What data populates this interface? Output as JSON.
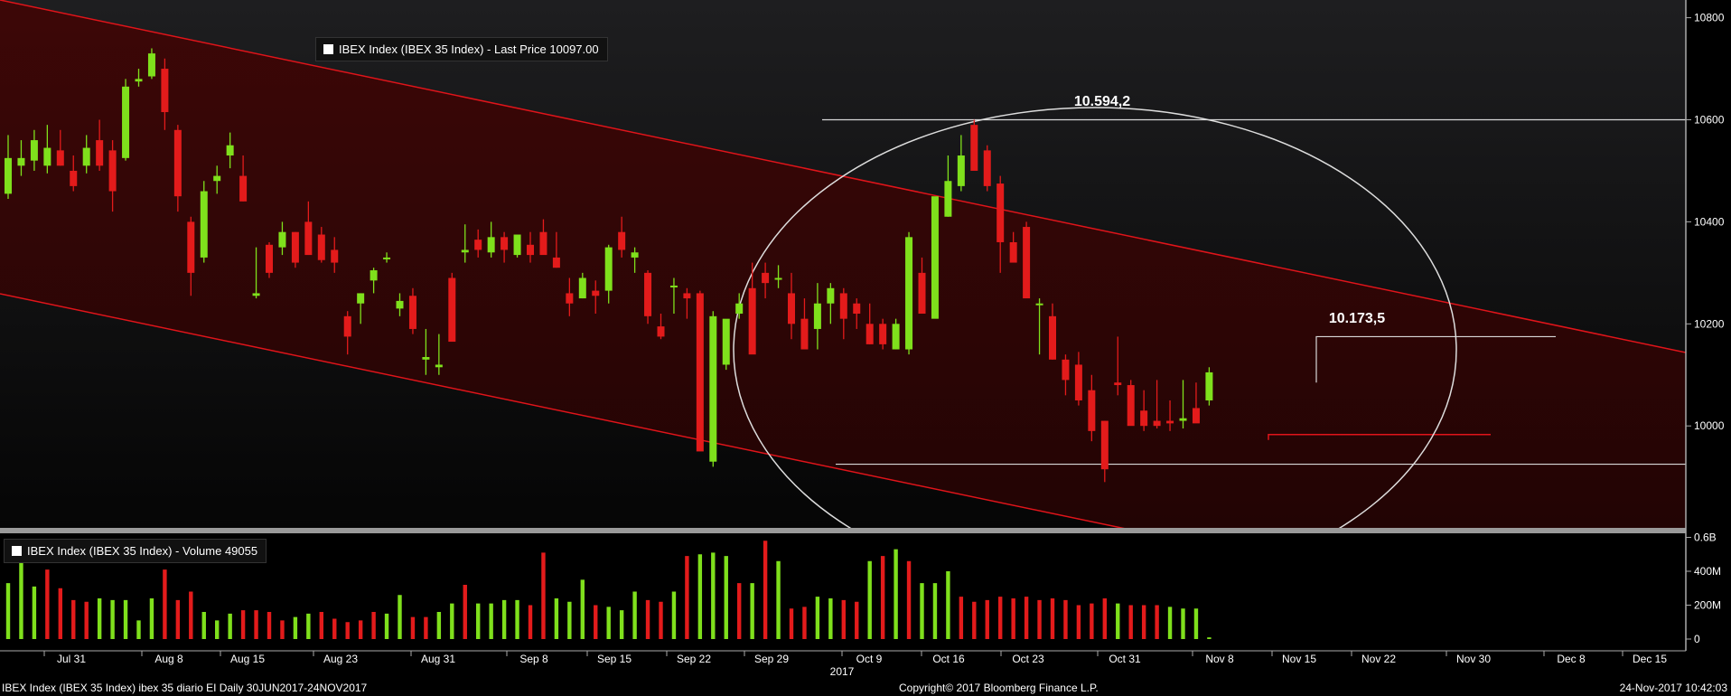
{
  "chart_data": [
    {
      "type": "candlestick",
      "legend": "IBEX Index (IBEX 35 Index) - Last Price 10097.00",
      "ylim": [
        9800,
        10830
      ],
      "y_ticks": [
        "10000",
        "10200",
        "10400",
        "10600",
        "10800"
      ],
      "x_ticks": [
        "Jul 31",
        "Aug 8",
        "Aug 15",
        "Aug 23",
        "Aug 31",
        "Sep 8",
        "Sep 15",
        "Sep 22",
        "Sep 29",
        "Oct 9",
        "Oct 16",
        "Oct 23",
        "Oct 31",
        "Nov 8",
        "Nov 15",
        "Nov 22",
        "Nov 30",
        "Dec 8",
        "Dec 15"
      ],
      "year_label": "2017",
      "ohlc": [
        [
          10455,
          10570,
          10445,
          10525
        ],
        [
          10510,
          10560,
          10490,
          10525
        ],
        [
          10520,
          10580,
          10500,
          10560
        ],
        [
          10510,
          10590,
          10495,
          10545
        ],
        [
          10540,
          10580,
          10510,
          10510
        ],
        [
          10500,
          10530,
          10460,
          10470
        ],
        [
          10510,
          10570,
          10495,
          10545
        ],
        [
          10560,
          10600,
          10500,
          10510
        ],
        [
          10540,
          10560,
          10420,
          10460
        ],
        [
          10525,
          10680,
          10520,
          10665
        ],
        [
          10675,
          10700,
          10665,
          10680
        ],
        [
          10685,
          10740,
          10680,
          10730
        ],
        [
          10700,
          10720,
          10580,
          10615
        ],
        [
          10580,
          10590,
          10420,
          10450
        ],
        [
          10400,
          10410,
          10255,
          10300
        ],
        [
          10330,
          10480,
          10320,
          10460
        ],
        [
          10480,
          10510,
          10455,
          10490
        ],
        [
          10530,
          10575,
          10505,
          10550
        ],
        [
          10490,
          10530,
          10440,
          10440
        ],
        [
          10255,
          10350,
          10250,
          10260
        ],
        [
          10355,
          10360,
          10290,
          10300
        ],
        [
          10350,
          10400,
          10335,
          10380
        ],
        [
          10380,
          10380,
          10310,
          10320
        ],
        [
          10400,
          10440,
          10340,
          10335
        ],
        [
          10375,
          10390,
          10320,
          10325
        ],
        [
          10345,
          10370,
          10300,
          10320
        ],
        [
          10215,
          10225,
          10140,
          10175
        ],
        [
          10240,
          10260,
          10200,
          10260
        ],
        [
          10285,
          10310,
          10260,
          10305
        ],
        [
          10330,
          10340,
          10320,
          10330
        ],
        [
          10230,
          10260,
          10215,
          10245
        ],
        [
          10255,
          10270,
          10180,
          10190
        ],
        [
          10130,
          10190,
          10100,
          10135
        ],
        [
          10115,
          10180,
          10100,
          10120
        ],
        [
          10290,
          10300,
          10170,
          10165
        ],
        [
          10340,
          10395,
          10320,
          10345
        ],
        [
          10365,
          10385,
          10330,
          10345
        ],
        [
          10340,
          10400,
          10330,
          10370
        ],
        [
          10370,
          10380,
          10320,
          10345
        ],
        [
          10335,
          10370,
          10330,
          10375
        ],
        [
          10355,
          10380,
          10320,
          10335
        ],
        [
          10380,
          10405,
          10340,
          10335
        ],
        [
          10330,
          10380,
          10310,
          10310
        ],
        [
          10260,
          10290,
          10215,
          10240
        ],
        [
          10250,
          10300,
          10250,
          10290
        ],
        [
          10265,
          10285,
          10220,
          10255
        ],
        [
          10265,
          10355,
          10240,
          10350
        ],
        [
          10380,
          10410,
          10330,
          10345
        ],
        [
          10330,
          10350,
          10300,
          10340
        ],
        [
          10300,
          10305,
          10200,
          10215
        ],
        [
          10195,
          10220,
          10170,
          10175
        ],
        [
          10275,
          10290,
          10220,
          10275
        ],
        [
          10260,
          10270,
          10210,
          10250
        ],
        [
          10260,
          10265,
          10000,
          9950
        ],
        [
          9930,
          10225,
          9920,
          10215
        ],
        [
          10120,
          10200,
          10110,
          10210
        ],
        [
          10220,
          10260,
          10210,
          10240
        ],
        [
          10270,
          10320,
          10160,
          10140
        ],
        [
          10300,
          10320,
          10250,
          10280
        ],
        [
          10290,
          10315,
          10270,
          10290
        ],
        [
          10260,
          10300,
          10170,
          10200
        ],
        [
          10210,
          10250,
          10180,
          10150
        ],
        [
          10190,
          10280,
          10150,
          10240
        ],
        [
          10240,
          10280,
          10200,
          10270
        ],
        [
          10260,
          10270,
          10170,
          10210
        ],
        [
          10240,
          10250,
          10190,
          10220
        ],
        [
          10200,
          10240,
          10160,
          10160
        ],
        [
          10200,
          10210,
          10150,
          10160
        ],
        [
          10150,
          10210,
          10150,
          10200
        ],
        [
          10150,
          10380,
          10140,
          10370
        ],
        [
          10300,
          10330,
          10270,
          10220
        ],
        [
          10210,
          10350,
          10220,
          10450
        ],
        [
          10410,
          10530,
          10410,
          10480
        ],
        [
          10470,
          10570,
          10460,
          10530
        ],
        [
          10590,
          10600,
          10530,
          10500
        ],
        [
          10540,
          10550,
          10460,
          10470
        ],
        [
          10475,
          10490,
          10300,
          10360
        ],
        [
          10360,
          10380,
          10330,
          10320
        ],
        [
          10390,
          10400,
          10280,
          10250
        ],
        [
          10240,
          10250,
          10140,
          10240
        ],
        [
          10215,
          10240,
          10130,
          10130
        ],
        [
          10130,
          10140,
          10060,
          10090
        ],
        [
          10120,
          10145,
          10040,
          10050
        ],
        [
          10070,
          10100,
          9970,
          9990
        ],
        [
          10010,
          10010,
          9890,
          9915
        ],
        [
          10085,
          10175,
          10060,
          10080
        ],
        [
          10080,
          10090,
          10040,
          10000
        ],
        [
          10030,
          10070,
          9990,
          10000
        ],
        [
          10010,
          10090,
          9995,
          10000
        ],
        [
          10010,
          10050,
          9990,
          10005
        ],
        [
          10010,
          10090,
          9995,
          10015
        ],
        [
          10035,
          10085,
          10035,
          10005
        ],
        [
          10050,
          10115,
          10040,
          10105
        ]
      ],
      "annotations": [
        {
          "text": "10.594,2",
          "value": 10594.2
        },
        {
          "text": "10.173,5",
          "value": 10173.5
        }
      ],
      "hlines": [
        10600,
        9925,
        9983,
        10175
      ]
    },
    {
      "type": "bar",
      "legend": "IBEX Index (IBEX 35 Index) - Volume 49055",
      "ylim": [
        -20,
        650
      ],
      "y_ticks": [
        "0",
        "200M",
        "400M",
        "0.6B"
      ],
      "values": [
        330,
        480,
        310,
        410,
        300,
        230,
        220,
        240,
        230,
        230,
        110,
        240,
        410,
        230,
        280,
        160,
        110,
        150,
        170,
        170,
        160,
        110,
        130,
        150,
        160,
        120,
        100,
        110,
        160,
        150,
        260,
        130,
        130,
        160,
        210,
        320,
        210,
        210,
        230,
        230,
        200,
        510,
        240,
        220,
        350,
        200,
        190,
        170,
        280,
        230,
        220,
        280,
        490,
        500,
        510,
        490,
        330,
        330,
        580,
        460,
        180,
        190,
        250,
        240,
        230,
        220,
        460,
        490,
        530,
        460,
        330,
        330,
        400,
        250,
        220,
        230,
        250,
        240,
        250,
        230,
        240,
        230,
        200,
        210,
        240,
        210,
        200,
        200,
        200,
        190,
        180,
        180,
        10
      ],
      "colors": [
        "#7fe01c",
        "#7fe01c",
        "#7fe01c",
        "#e31b1b",
        "#e31b1b",
        "#e31b1b",
        "#e31b1b",
        "#7fe01c",
        "#7fe01c",
        "#7fe01c",
        "#7fe01c",
        "#7fe01c",
        "#e31b1b",
        "#e31b1b",
        "#e31b1b",
        "#7fe01c",
        "#7fe01c",
        "#7fe01c",
        "#e31b1b",
        "#e31b1b",
        "#e31b1b",
        "#e31b1b",
        "#7fe01c",
        "#7fe01c",
        "#e31b1b",
        "#e31b1b",
        "#e31b1b",
        "#e31b1b",
        "#e31b1b",
        "#7fe01c",
        "#7fe01c",
        "#e31b1b",
        "#e31b1b",
        "#7fe01c",
        "#7fe01c",
        "#e31b1b",
        "#7fe01c",
        "#7fe01c",
        "#7fe01c",
        "#7fe01c",
        "#e31b1b",
        "#e31b1b",
        "#7fe01c",
        "#7fe01c",
        "#7fe01c",
        "#e31b1b",
        "#7fe01c",
        "#7fe01c",
        "#7fe01c",
        "#e31b1b",
        "#e31b1b",
        "#7fe01c",
        "#e31b1b",
        "#7fe01c",
        "#7fe01c",
        "#7fe01c",
        "#e31b1b",
        "#7fe01c",
        "#e31b1b",
        "#7fe01c",
        "#e31b1b",
        "#e31b1b",
        "#7fe01c",
        "#7fe01c",
        "#e31b1b",
        "#e31b1b",
        "#7fe01c",
        "#e31b1b",
        "#7fe01c",
        "#e31b1b",
        "#7fe01c",
        "#7fe01c",
        "#7fe01c",
        "#e31b1b",
        "#e31b1b",
        "#e31b1b",
        "#e31b1b",
        "#e31b1b",
        "#e31b1b",
        "#e31b1b",
        "#e31b1b",
        "#e31b1b",
        "#e31b1b",
        "#e31b1b",
        "#e31b1b",
        "#7fe01c",
        "#e31b1b",
        "#e31b1b",
        "#e31b1b",
        "#7fe01c",
        "#7fe01c",
        "#7fe01c",
        "#7fe01c"
      ]
    }
  ],
  "colors": {
    "up": "#7fe01c",
    "down": "#e31b1b",
    "channel_line": "#e0141a",
    "channel_fill": "#3a0a0a"
  },
  "footer": {
    "left": "IBEX Index (IBEX 35 Index) ibex 35 diario EI  Daily 30JUN2017-24NOV2017",
    "center": "Copyright© 2017 Bloomberg Finance L.P.",
    "right": "24-Nov-2017 10:42:03"
  }
}
